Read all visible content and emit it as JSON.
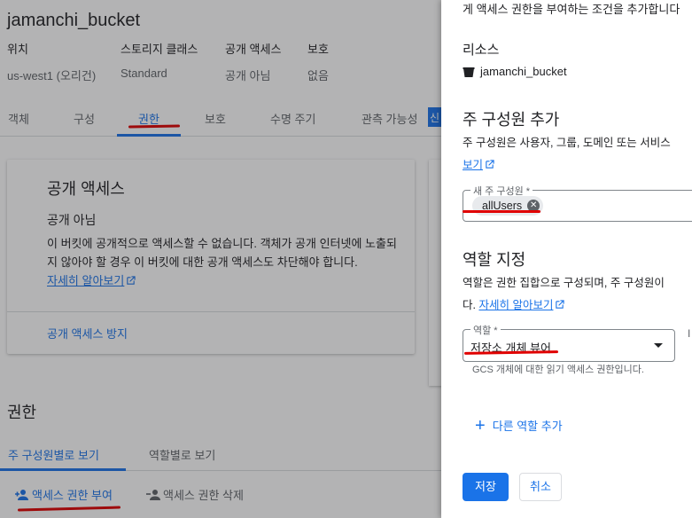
{
  "bucket": {
    "name": "jamanchi_bucket"
  },
  "meta": [
    {
      "key": "위치",
      "value": "us-west1 (오리건)"
    },
    {
      "key": "스토리지 클래스",
      "value": "Standard"
    },
    {
      "key": "공개 액세스",
      "value": "공개 아님"
    },
    {
      "key": "보호",
      "value": "없음"
    }
  ],
  "tabs": [
    "객체",
    "구성",
    "권한",
    "보호",
    "수명 주기",
    "관측 가능성"
  ],
  "active_tab": "권한",
  "tab_badge": "신",
  "public_access_card": {
    "title": "공개 액세스",
    "status": "공개 아님",
    "description": "이 버킷에 공개적으로 액세스할 수 없습니다. 객체가 공개 인터넷에 노출되지 않아야 할 경우 이 버킷에 대한 공개 액세스도 차단해야 합니다.",
    "learn_more": "자세히 알아보기",
    "action": "공개 액세스 방지"
  },
  "permissions": {
    "title": "권한",
    "subtabs": [
      "주 구성원별로 보기",
      "역할별로 보기"
    ],
    "grant_access": "액세스 권한 부여",
    "remove_access": "액세스 권한 삭제"
  },
  "panel": {
    "top_text": "게 액세스 권한을 부여하는 조건을 추가합니다",
    "resource_heading": "리소스",
    "resource_name": "jamanchi_bucket",
    "add_principals_heading": "주 구성원 추가",
    "principals_desc_1": "주 구성원은 사용자, 그룹, 도메인 또는 서비스",
    "principals_desc_link": "보기",
    "new_principals_label": "새 주 구성원 *",
    "principal_chip": "allUsers",
    "assign_roles_heading": "역할 지정",
    "roles_desc_1": "역할은 권한 집합으로 구성되며, 주 구성원이",
    "roles_desc_2_prefix": "다.",
    "roles_desc_link": "자세히 알아보기",
    "role_label": "역할 *",
    "role_value": "저장소 개체 뷰어",
    "role_hint": "GCS 개체에 대한 읽기 액세스 권한입니다.",
    "add_role": "다른 역할 추가",
    "save": "저장",
    "cancel": "취소",
    "cut_letter": "I"
  },
  "colors": {
    "accent": "#1a73e8",
    "annotation": "#e00000"
  }
}
